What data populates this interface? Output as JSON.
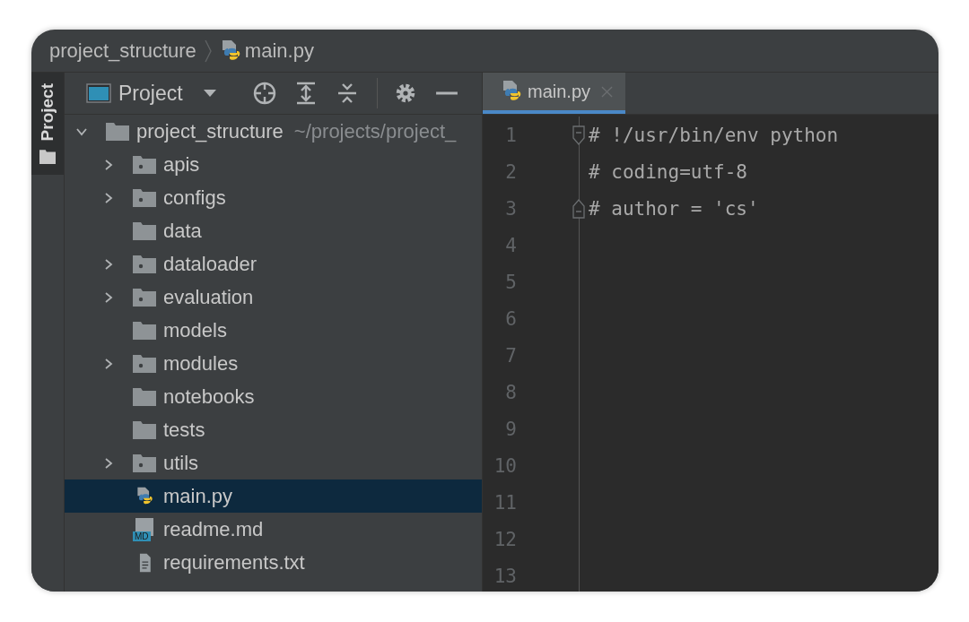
{
  "breadcrumb": [
    {
      "label": "project_structure",
      "kind": "folder"
    },
    {
      "label": "main.py",
      "kind": "python"
    }
  ],
  "tool_strip": {
    "label": "Project",
    "selected": true
  },
  "project_toolbar": {
    "title": "Project"
  },
  "tree": {
    "name": "project_structure",
    "path": "~/projects/project_",
    "expanded": true,
    "children": [
      {
        "name": "apis",
        "kind": "package",
        "expanded": false,
        "selected": false
      },
      {
        "name": "configs",
        "kind": "package",
        "expanded": false,
        "selected": false
      },
      {
        "name": "data",
        "kind": "folder",
        "selected": false
      },
      {
        "name": "dataloader",
        "kind": "package",
        "expanded": false,
        "selected": false
      },
      {
        "name": "evaluation",
        "kind": "package",
        "expanded": false,
        "selected": false
      },
      {
        "name": "models",
        "kind": "folder",
        "selected": false
      },
      {
        "name": "modules",
        "kind": "package",
        "expanded": false,
        "selected": false
      },
      {
        "name": "notebooks",
        "kind": "folder",
        "selected": false
      },
      {
        "name": "tests",
        "kind": "folder",
        "selected": false
      },
      {
        "name": "utils",
        "kind": "package",
        "expanded": false,
        "selected": false
      },
      {
        "name": "main.py",
        "kind": "python",
        "selected": true
      },
      {
        "name": "readme.md",
        "kind": "markdown",
        "badge": "MD",
        "selected": false
      },
      {
        "name": "requirements.txt",
        "kind": "text",
        "selected": false
      }
    ]
  },
  "editor_tabs": [
    {
      "label": "main.py",
      "kind": "python",
      "selected": true
    }
  ],
  "editor": {
    "lines": [
      {
        "number": "1",
        "code": "# !/usr/bin/env python",
        "kind": "fold_start"
      },
      {
        "number": "2",
        "code": "# coding=utf-8",
        "kind": "plain"
      },
      {
        "number": "3",
        "code": "# author = 'cs'",
        "kind": "fold_end"
      },
      {
        "number": "4"
      },
      {
        "number": "5"
      },
      {
        "number": "6"
      },
      {
        "number": "7"
      },
      {
        "number": "8"
      },
      {
        "number": "9"
      },
      {
        "number": "10"
      },
      {
        "number": "11"
      },
      {
        "number": "12"
      },
      {
        "number": "13"
      }
    ]
  }
}
